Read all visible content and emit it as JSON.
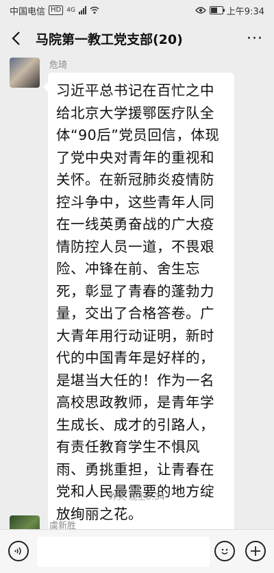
{
  "status_bar": {
    "carrier": "中国电信",
    "hd": "HD",
    "network": "4G",
    "time": "上午9:34",
    "battery_level": 0.55
  },
  "header": {
    "title": "马院第一教工党支部(20)"
  },
  "messages": [
    {
      "sender": "危琦",
      "text": "习近平总书记在百忙之中给北京大学援鄂医疗队全体“90后”党员回信，体现了党中央对青年的重视和关怀。在新冠肺炎疫情防控斗争中，这些青年人同在一线英勇奋战的广大疫情防控人员一道，不畏艰险、冲锋在前、舍生忘死，彰显了青春的蓬勃力量，交出了合格答卷。广大青年用行动证明，新时代的中国青年是好样的，是堪当大任的！作为一名高校思政教师，是青年学生成长、成才的引路人，有责任教育学生不惧风雨、勇挑重担，让青春在党和人民最需要的地方绽放绚丽之花。"
    },
    {
      "sender": "虞新胜"
    }
  ],
  "timestamp": "昨天 晚上8:34",
  "icons": {
    "back": "back-arrow-icon",
    "more": "more-icon",
    "voice": "voice-icon",
    "emoji": "emoji-icon",
    "plus": "plus-icon"
  }
}
